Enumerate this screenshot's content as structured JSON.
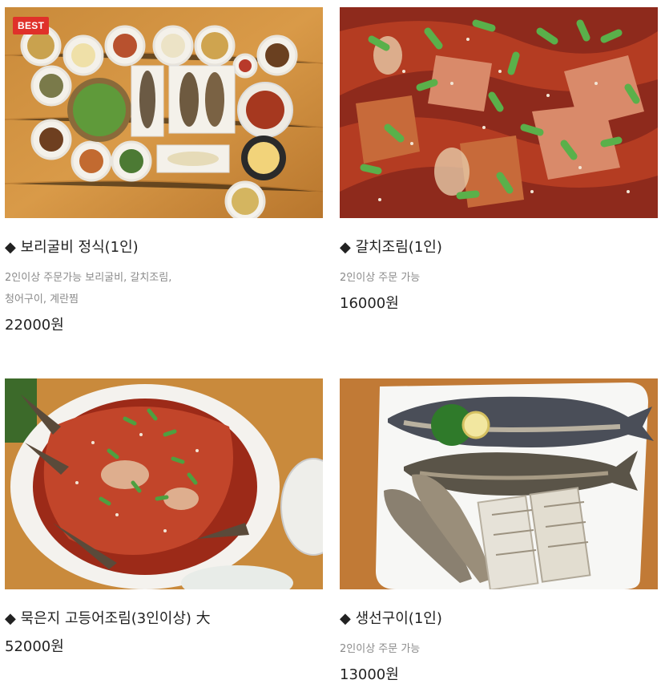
{
  "menu": [
    {
      "badge": "BEST",
      "title": "◆ 보리굴비 정식(1인)",
      "desc": "2인이상 주문가능 보리굴비, 갈치조림, 청어구이, 계란찜",
      "price": "22000원",
      "image": "barley-croaker-set-meal-photo"
    },
    {
      "title": "◆ 갈치조림(1인)",
      "desc": "2인이상 주문 가능",
      "price": "16000원",
      "image": "braised-hairtail-photo"
    },
    {
      "title": "◆ 묵은지 고등어조림(3인이상) 大",
      "price": "52000원",
      "image": "braised-mackerel-kimchi-photo"
    },
    {
      "title": "◆ 생선구이(1인)",
      "desc": "2인이상 주문 가능",
      "price": "13000원",
      "image": "grilled-fish-photo"
    }
  ],
  "colors": {
    "badge": "#e0312a",
    "price_text": "#222222",
    "desc_text": "#8a8a8a"
  }
}
